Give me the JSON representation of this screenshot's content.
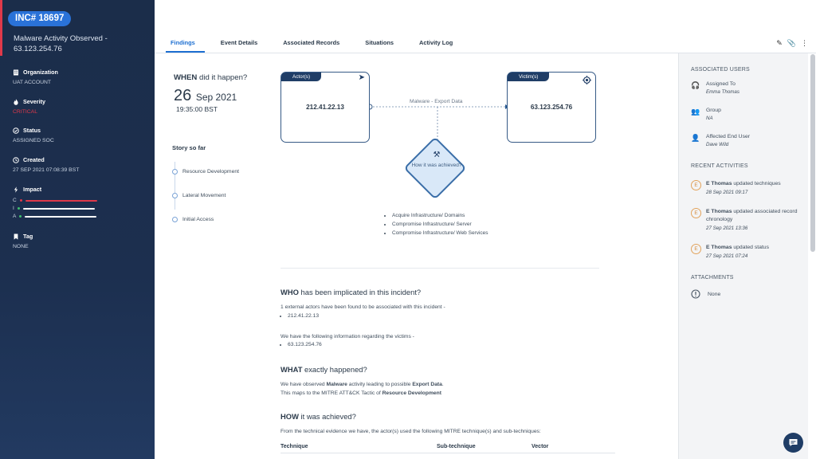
{
  "incident": {
    "id": "INC# 18697",
    "title": "Malware Activity Observed - 63.123.254.76",
    "fields": [
      {
        "label": "Organization",
        "value": "UAT ACCOUNT",
        "icon": "building-icon"
      },
      {
        "label": "Severity",
        "value": "CRITICAL",
        "icon": "flame-icon"
      },
      {
        "label": "Status",
        "value": "ASSIGNED SOC",
        "icon": "check-circle-icon"
      },
      {
        "label": "Created",
        "value": "27 SEP 2021 07:08:39 BST",
        "icon": "clock-icon"
      }
    ],
    "impact": {
      "label": "Impact",
      "rows": [
        {
          "letter": "C",
          "color": "#e0394a",
          "level": 1.0
        },
        {
          "letter": "I",
          "color": "#ffffff",
          "level": 1.0
        },
        {
          "letter": "A",
          "color": "#ffffff",
          "level": 1.0
        }
      ]
    },
    "tag": {
      "label": "Tag",
      "value": "NONE"
    }
  },
  "tabs": [
    "Findings",
    "Event Details",
    "Associated Records",
    "Situations",
    "Activity Log"
  ],
  "active_tab": "Findings",
  "when": {
    "q_bold": "WHEN",
    "q_rest": " did it happen?",
    "day": "26",
    "month_year": "Sep 2021",
    "time": "19:35:00 BST"
  },
  "story": {
    "title": "Story so far",
    "items": [
      "Resource Development",
      "Lateral Movement",
      "Initial Access"
    ]
  },
  "flow": {
    "actor_label": "Actor(s)",
    "actor_value": "212.41.22.13",
    "victim_label": "Victim(s)",
    "victim_value": "63.123.254.76",
    "edge_label": "Malware - Export Data",
    "how_label": "How it was achieved?",
    "techniques": [
      "Acquire Infrastructure/ Domains",
      "Compromise Infrastructure/ Server",
      "Compromise Infrastructure/ Web Services"
    ]
  },
  "who": {
    "q_bold": "WHO",
    "q_rest": " has been implicated in this incident?",
    "actors_text": "1 external actors have been found to be associated with this incident -",
    "actors": [
      "212.41.22.13"
    ],
    "victims_text": "We have the following information regarding the victims -",
    "victims": [
      "63.123.254.76"
    ]
  },
  "what": {
    "q_bold": "WHAT",
    "q_rest": " exactly happened?",
    "l1_a": "We have observed ",
    "l1_b": "Malware",
    "l1_c": " activity leading to possible ",
    "l1_d": "Export Data",
    "l1_e": ".",
    "l2_a": "This maps to the MITRE ATT&CK Tactic of ",
    "l2_b": "Resource Development"
  },
  "how": {
    "q_bold": "HOW",
    "q_rest": " it was achieved?",
    "text": "From the technical evidence we have, the actor(s) used the following MITRE technique(s) and sub-techniques:",
    "columns": [
      "Technique",
      "Sub-technique",
      "Vector"
    ]
  },
  "right": {
    "assoc_title": "ASSOCIATED USERS",
    "assigned_label": "Assigned To",
    "assigned_value": "Emma Thomas",
    "group_label": "Group",
    "group_value": "NA",
    "enduser_label": "Affected End User",
    "enduser_value": "Dave Wild",
    "recent_title": "RECENT ACTIVITIES",
    "activities": [
      {
        "avatar": "E",
        "user": "E Thomas",
        "text": " updated techniques",
        "date": "28 Sep 2021 09:17"
      },
      {
        "avatar": "E",
        "user": "E Thomas",
        "text": " updated associated record chronology",
        "date": "27 Sep 2021 13:36"
      },
      {
        "avatar": "E",
        "user": "E Thomas",
        "text": " updated status",
        "date": "27 Sep 2021 07:24"
      }
    ],
    "attach_title": "ATTACHMENTS",
    "attach_value": "None"
  },
  "colors": {
    "accent": "#1d6fd1",
    "sidebar": "#1b2d4a",
    "critical": "#e0394a"
  }
}
